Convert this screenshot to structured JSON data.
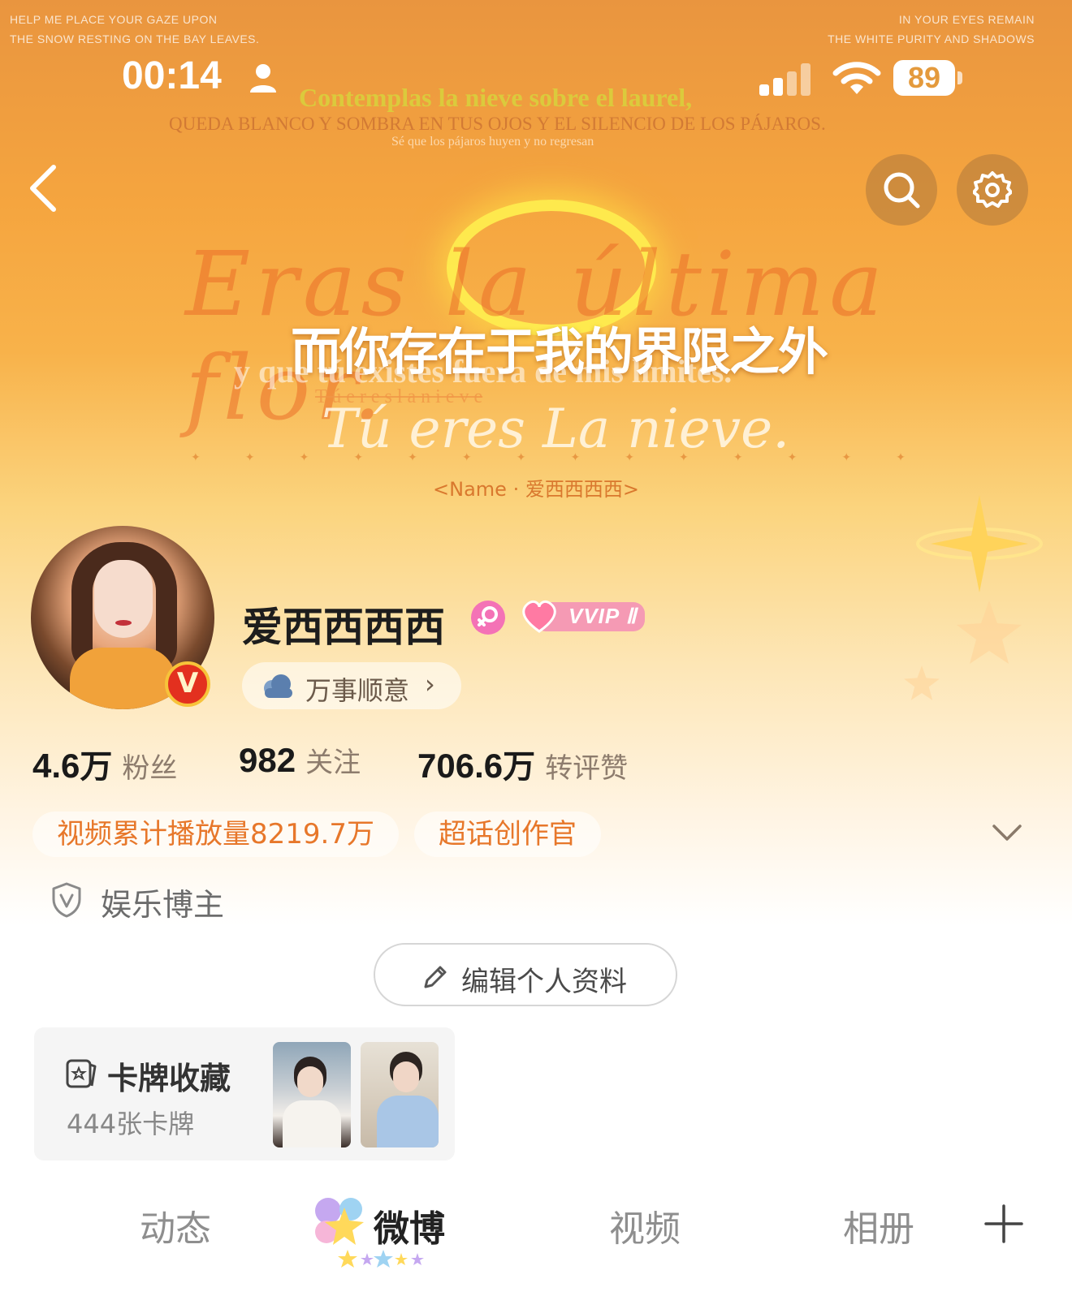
{
  "status_bar": {
    "time": "00:14",
    "battery": "89"
  },
  "decor": {
    "left_lines": [
      "HELP ME PLACE YOUR GAZE UPON",
      "THE SNOW RESTING ON THE BAY LEAVES."
    ],
    "right_lines": [
      "IN YOUR EYES REMAIN",
      "THE WHITE PURITY AND SHADOWS"
    ],
    "line1": "Contemplas la nieve sobre el laurel,",
    "line2": "QUEDA BLANCO Y SOMBRA EN TUS OJOS Y EL SILENCIO DE LOS PÁJAROS.",
    "line3": "Sé que los pájaros huyen y no regresan",
    "cursive1": "Eras la última flor.",
    "chinese": "而你存在于我的界限之外",
    "spanish": "y que tú existes fuera de mis límites.",
    "spaced": "T ú   e r e s   l a   n i e v e",
    "cursive2": "Tú eres La nieve.",
    "name_tag": "<Name · 爱西西西西>"
  },
  "profile": {
    "username": "爱西西西西",
    "vvip": "VVIP Ⅱ",
    "wish": "万事顺意",
    "verified_mark": "V"
  },
  "stats": [
    {
      "num": "4.6",
      "unit": "万",
      "label": "粉丝"
    },
    {
      "num": "982",
      "unit": "",
      "label": "关注"
    },
    {
      "num": "706.6",
      "unit": "万",
      "label": "转评赞"
    }
  ],
  "tags": [
    "视频累计播放量8219.7万",
    "超话创作官"
  ],
  "category": "娱乐博主",
  "edit_label": "编辑个人资料",
  "cards": {
    "title": "卡牌收藏",
    "count": "444张卡牌"
  },
  "tabs": [
    "动态",
    "微博",
    "视频",
    "相册"
  ],
  "active_tab": "微博",
  "colors": {
    "accent": "#e7772a",
    "hero_top": "#e9953f",
    "hero_mid": "#f8b24a"
  }
}
